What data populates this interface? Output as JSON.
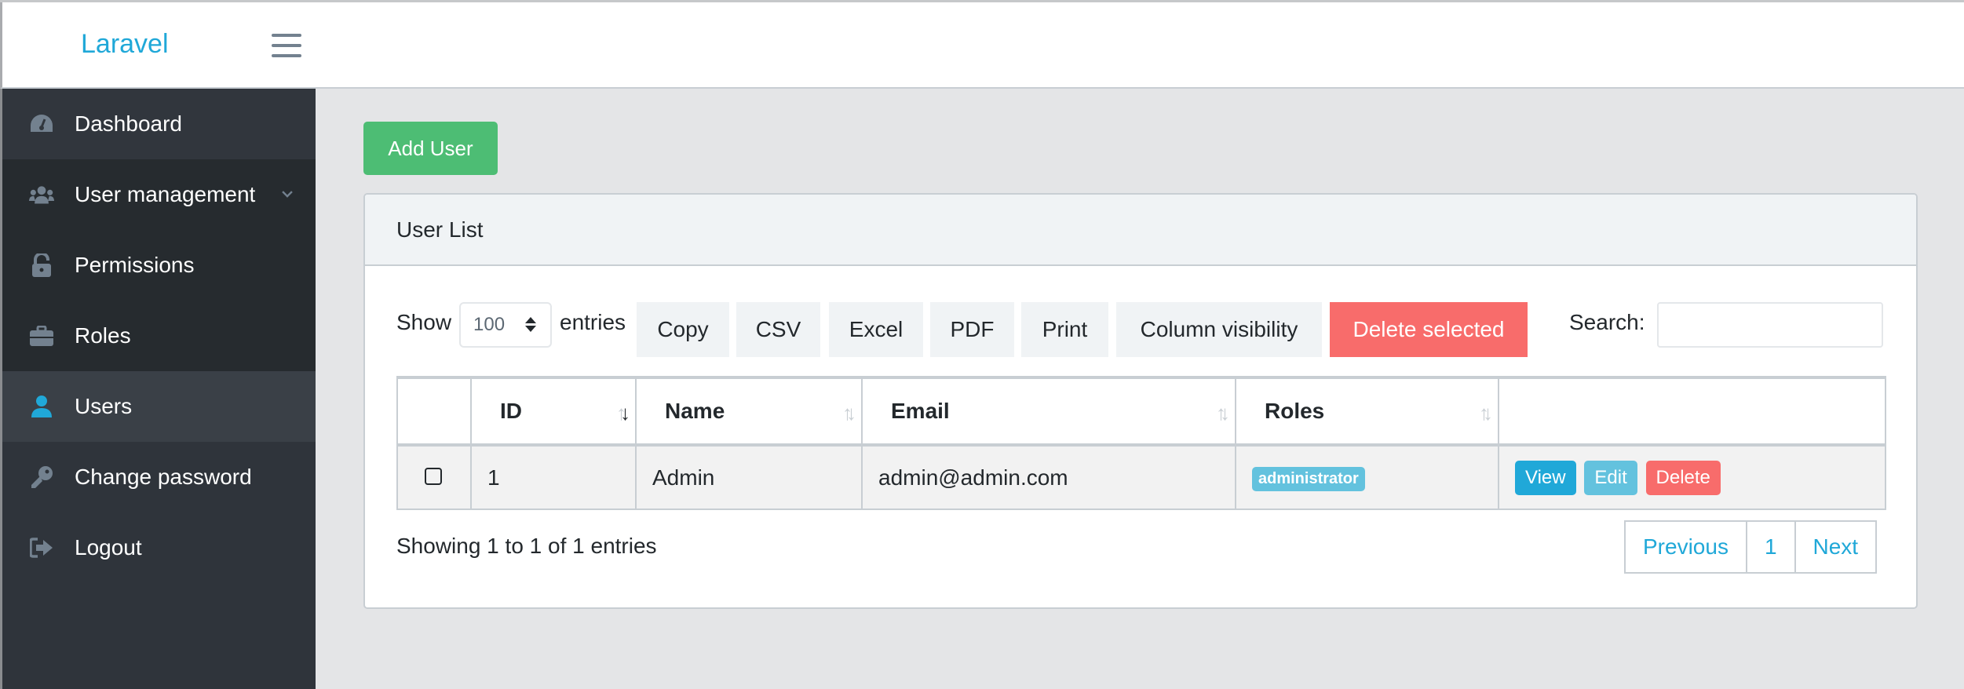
{
  "header": {
    "brand": "Laravel",
    "menu_icon": "hamburger-icon"
  },
  "sidebar": {
    "items": [
      {
        "label": "Dashboard",
        "icon": "tachometer-icon"
      },
      {
        "label": "User management",
        "icon": "users-icon",
        "expandable": true
      },
      {
        "label": "Permissions",
        "icon": "unlock-icon"
      },
      {
        "label": "Roles",
        "icon": "briefcase-icon"
      },
      {
        "label": "Users",
        "icon": "user-icon",
        "active": true
      },
      {
        "label": "Change password",
        "icon": "key-icon"
      },
      {
        "label": "Logout",
        "icon": "sign-out-icon"
      }
    ]
  },
  "main": {
    "add_user_label": "Add User",
    "card_title": "User List",
    "toolbar": {
      "show_label": "Show",
      "page_length": "100",
      "entries_label": "entries",
      "buttons": [
        "Copy",
        "CSV",
        "Excel",
        "PDF",
        "Print",
        "Column visibility",
        "Delete selected"
      ],
      "search_label": "Search:",
      "search_value": ""
    },
    "table": {
      "columns": [
        "",
        "ID",
        "Name",
        "Email",
        "Roles",
        ""
      ],
      "rows": [
        {
          "id": "1",
          "name": "Admin",
          "email": "admin@admin.com",
          "roles": [
            "administrator"
          ],
          "actions": [
            "View",
            "Edit",
            "Delete"
          ]
        }
      ]
    },
    "info": "Showing 1 to 1 of 1 entries",
    "pagination": {
      "previous": "Previous",
      "pages": [
        "1"
      ],
      "next": "Next"
    }
  },
  "colors": {
    "brand": "#20a8d8",
    "success": "#4dbd74",
    "danger": "#f86c6b",
    "info": "#63c2de",
    "primary": "#20a8d8",
    "sidebar": "#2f353a"
  }
}
